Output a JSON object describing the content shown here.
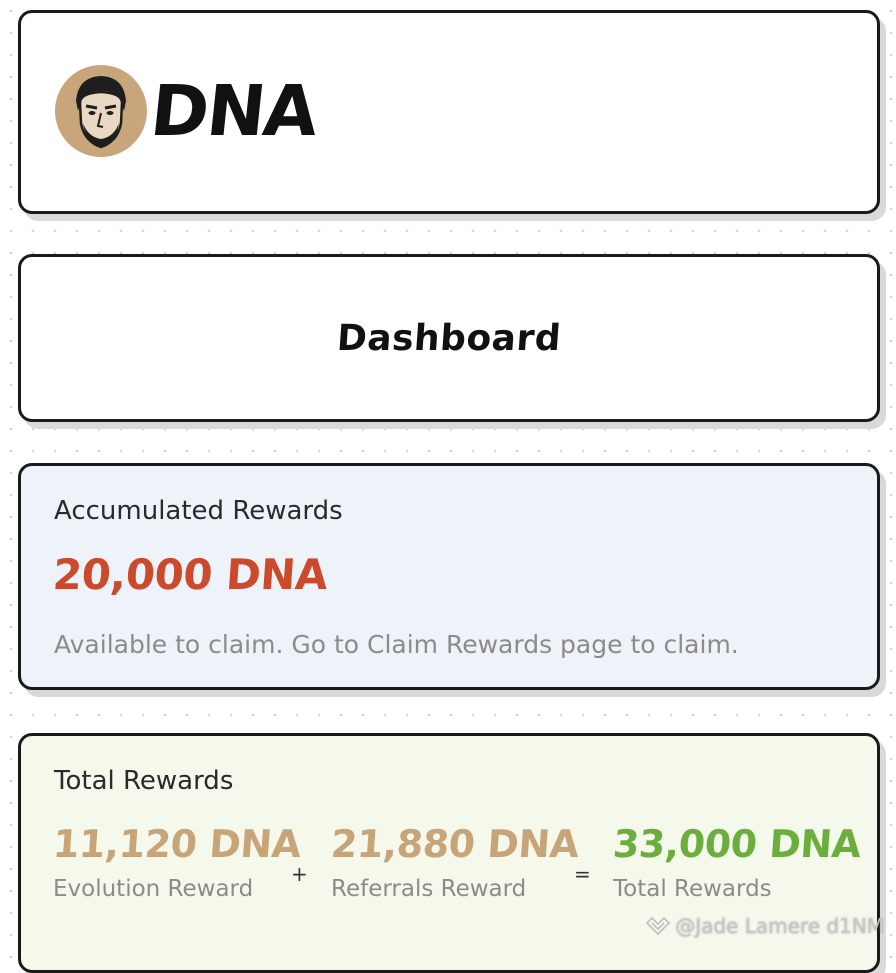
{
  "header": {
    "logo_text": "DNA",
    "avatar_icon": "face-portrait-icon",
    "avatar_bg": "#c9a57b"
  },
  "page": {
    "title": "Dashboard"
  },
  "accumulated": {
    "label": "Accumulated Rewards",
    "value": "20,000 DNA",
    "value_color": "#cc4a2c",
    "note": "Available to claim. Go to Claim Rewards page to claim.",
    "bg": "#eef3fa"
  },
  "total": {
    "label": "Total Rewards",
    "bg": "#f4f9ec",
    "items": [
      {
        "value": "11,120 DNA",
        "caption": "Evolution Reward",
        "color": "#c8a479"
      },
      {
        "value": "21,880 DNA",
        "caption": "Referrals Reward",
        "color": "#c8a479"
      },
      {
        "value": "33,000 DNA",
        "caption": "Total Rewards",
        "color": "#6cae3e"
      }
    ],
    "plus": "+",
    "equals": "="
  },
  "watermark": {
    "text": "@Jade Lamere d1NM",
    "icon": "diamond-logo-icon"
  }
}
